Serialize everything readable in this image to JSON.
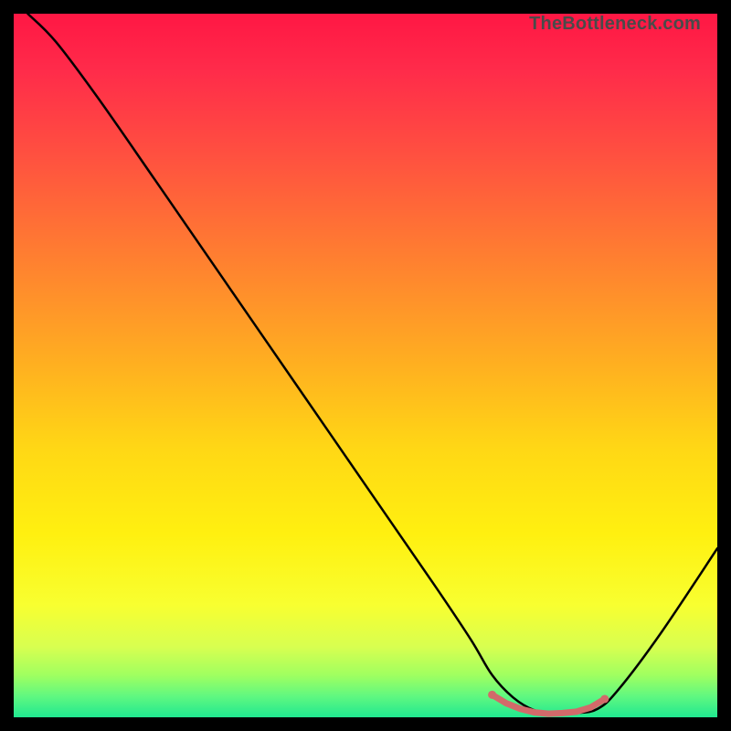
{
  "watermark": "TheBottleneck.com",
  "chart_data": {
    "type": "line",
    "title": "",
    "xlabel": "",
    "ylabel": "",
    "xlim": [
      0,
      100
    ],
    "ylim": [
      0,
      100
    ],
    "grid": false,
    "legend": false,
    "gradient_stops": [
      {
        "offset": 0.0,
        "color": "#ff1744"
      },
      {
        "offset": 0.08,
        "color": "#ff2b4a"
      },
      {
        "offset": 0.2,
        "color": "#ff5040"
      },
      {
        "offset": 0.35,
        "color": "#ff8030"
      },
      {
        "offset": 0.5,
        "color": "#ffb020"
      },
      {
        "offset": 0.62,
        "color": "#ffd815"
      },
      {
        "offset": 0.74,
        "color": "#fff010"
      },
      {
        "offset": 0.84,
        "color": "#f8ff30"
      },
      {
        "offset": 0.9,
        "color": "#d8ff50"
      },
      {
        "offset": 0.94,
        "color": "#a0ff60"
      },
      {
        "offset": 0.97,
        "color": "#60f880"
      },
      {
        "offset": 1.0,
        "color": "#20e890"
      }
    ],
    "series": [
      {
        "name": "bottleneck-curve",
        "stroke": "#000000",
        "stroke_width": 2.5,
        "x": [
          2,
          6,
          12,
          20,
          30,
          40,
          50,
          60,
          65,
          68,
          71,
          74,
          77,
          80,
          83,
          86,
          92,
          100
        ],
        "y": [
          100,
          96,
          88,
          76.5,
          62,
          47.5,
          33,
          18.5,
          11,
          6,
          2.8,
          1.0,
          0.5,
          0.6,
          1.2,
          4,
          12,
          24
        ]
      },
      {
        "name": "optimal-zone",
        "stroke": "#d26a6a",
        "stroke_width": 7,
        "dot_radius": 4.5,
        "x": [
          68,
          70,
          72,
          74,
          76,
          78,
          80,
          82,
          84
        ],
        "y": [
          3.2,
          2.0,
          1.2,
          0.7,
          0.5,
          0.6,
          0.8,
          1.4,
          2.6
        ]
      }
    ]
  }
}
